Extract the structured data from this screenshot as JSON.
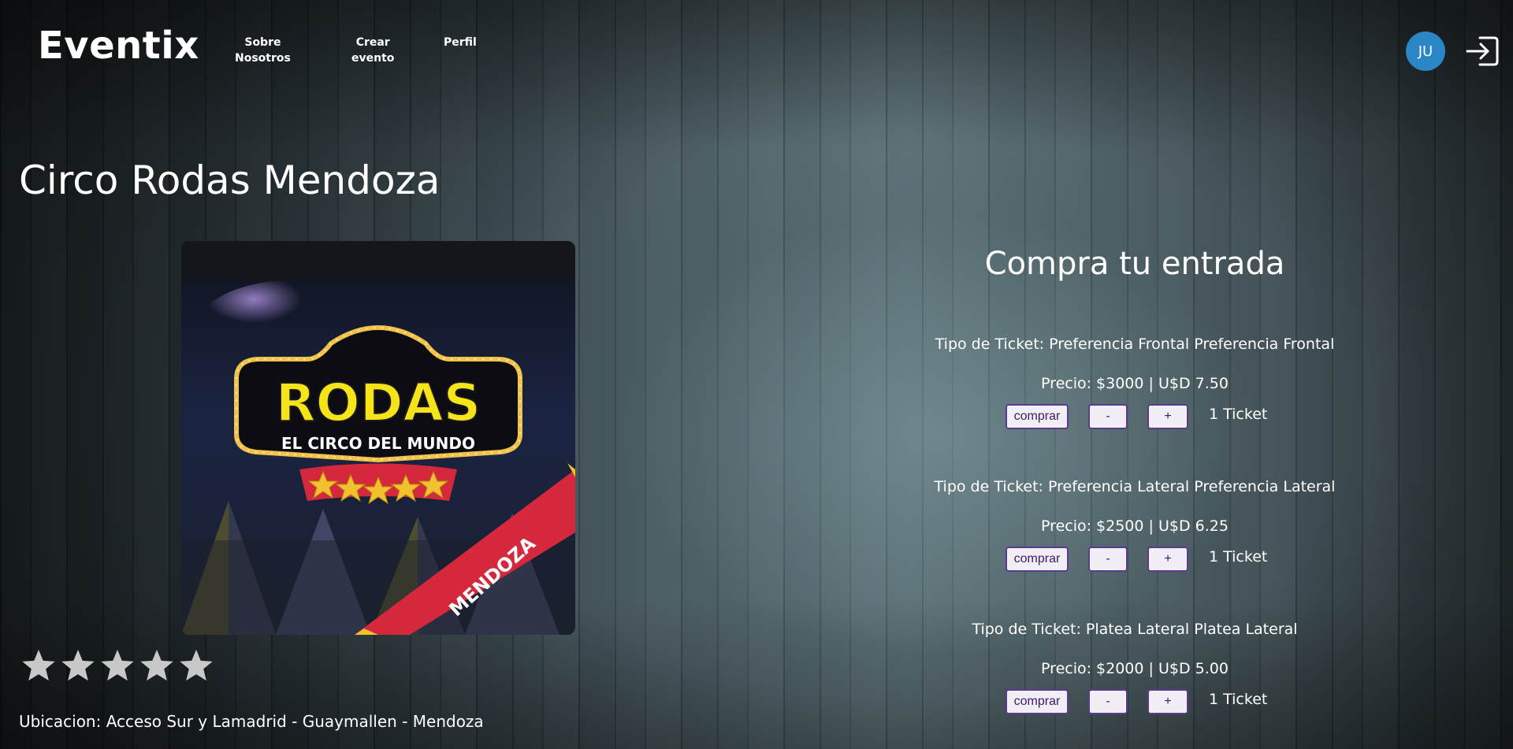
{
  "header": {
    "logo": "Eventix",
    "nav": [
      {
        "label_line1": "Sobre",
        "label_line2": "Nosotros"
      },
      {
        "label_line1": "Crear",
        "label_line2": "evento"
      },
      {
        "label_line1": "Perfil",
        "label_line2": ""
      }
    ],
    "avatar_initials": "JU",
    "logout_icon": "logout-icon"
  },
  "event": {
    "title": "Circo Rodas Mendoza",
    "poster": {
      "brand": "RODAS",
      "tagline": "EL CIRCO DEL MUNDO",
      "ribbon": "MENDOZA"
    },
    "rating_stars": 5,
    "location": "Ubicacion: Acceso Sur y Lamadrid - Guaymallen - Mendoza"
  },
  "purchase": {
    "title": "Compra tu entrada",
    "tickets": [
      {
        "type": "Tipo de Ticket: Preferencia Frontal Preferencia Frontal",
        "price": "Precio: $3000 | U$D 7.50",
        "buy_label": "comprar",
        "minus_label": "-",
        "plus_label": "+",
        "quantity": "1 Ticket"
      },
      {
        "type": "Tipo de Ticket: Preferencia Lateral Preferencia Lateral",
        "price": "Precio: $2500 | U$D 6.25",
        "buy_label": "comprar",
        "minus_label": "-",
        "plus_label": "+",
        "quantity": "1 Ticket"
      },
      {
        "type": "Tipo de Ticket: Platea Lateral Platea Lateral",
        "price": "Precio: $2000 | U$D 5.00",
        "buy_label": "comprar",
        "minus_label": "-",
        "plus_label": "+",
        "quantity": "1 Ticket"
      }
    ]
  },
  "colors": {
    "avatar": "#2b86c5",
    "button_border": "#5b3a8f",
    "button_text": "#3d1a6d",
    "poster_yellow": "#f5e41a",
    "ribbon_red": "#d6283c",
    "star": "#c8c8c8"
  }
}
